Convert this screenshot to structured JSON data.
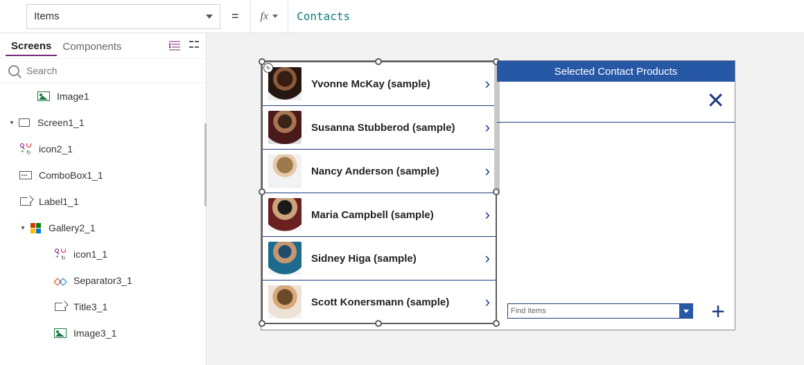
{
  "formula": {
    "property": "Items",
    "fx_label": "fx",
    "value": "Contacts",
    "equals": "="
  },
  "tree_panel": {
    "tabs": {
      "screens": "Screens",
      "components": "Components"
    },
    "search_placeholder": "Search",
    "items": {
      "image1": "Image1",
      "screen1_1": "Screen1_1",
      "icon2_1": "icon2_1",
      "combobox1_1": "ComboBox1_1",
      "label1_1": "Label1_1",
      "gallery2_1": "Gallery2_1",
      "icon1_1": "icon1_1",
      "separator3_1": "Separator3_1",
      "title3_1": "Title3_1",
      "image3_1": "Image3_1"
    }
  },
  "canvas": {
    "header_title": "Selected Contact Products",
    "combobox_placeholder": "Find items",
    "contacts": [
      {
        "name": "Yvonne McKay (sample)"
      },
      {
        "name": "Susanna Stubberod (sample)"
      },
      {
        "name": "Nancy Anderson (sample)"
      },
      {
        "name": "Maria Campbell (sample)"
      },
      {
        "name": "Sidney Higa (sample)"
      },
      {
        "name": "Scott Konersmann (sample)"
      }
    ]
  }
}
